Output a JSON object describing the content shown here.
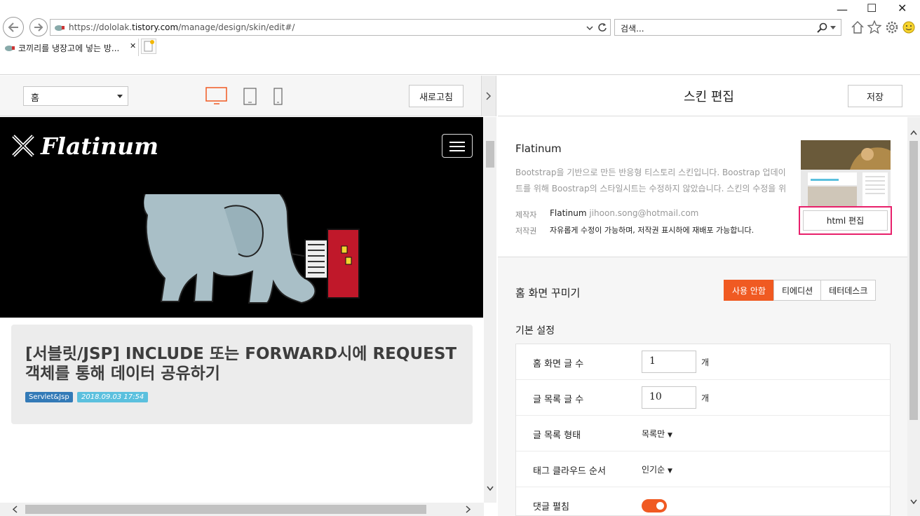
{
  "browser": {
    "url_prefix": "https://dololak.",
    "url_domain": "tistory.com",
    "url_path": "/manage/design/skin/edit#/",
    "search_placeholder": "검색...",
    "tab_title": "코끼리를 냉장고에 넣는 방..."
  },
  "preview_toolbar": {
    "page_select": "홈",
    "refresh_label": "새로고침"
  },
  "preview": {
    "logo_text": "Flatinum",
    "post_title": "[서블릿/JSP] INCLUDE 또는 FORWARD시에 REQUEST 객체를 통해 데이터 공유하기",
    "category": "Servlet&Jsp",
    "date": "2018.09.03 17:54"
  },
  "panel": {
    "title": "스킨 편집",
    "save_label": "저장",
    "skin": {
      "name": "Flatinum",
      "description": "Bootstrap을 기반으로 만든 반응형 티스토리 스킨입니다. Boostrap 업데이트를 위해 Boostrap의 스타일시트는 수정하지 않았습니다. 스킨의 수정을 위",
      "author_label": "제작자",
      "author_name": "Flatinum",
      "author_email": "jihoon.song@hotmail.com",
      "copyright_label": "저작권",
      "copyright_text": "자유롭게 수정이 가능하며, 저작권 표시하에 재배포 가능합니다.",
      "html_edit_label": "html 편집"
    },
    "home_deco": {
      "label": "홈 화면 꾸미기",
      "options": [
        "사용 안함",
        "티에디션",
        "테터데스크"
      ],
      "selected": "사용 안함"
    },
    "basic": {
      "label": "기본 설정",
      "home_posts_label": "홈 화면 글 수",
      "home_posts_value": "1",
      "list_posts_label": "글 목록 글 수",
      "list_posts_value": "10",
      "unit": "개",
      "list_type_label": "글 목록 형태",
      "list_type_value": "목록만",
      "tag_order_label": "태그 클라우드 순서",
      "tag_order_value": "인기순",
      "comments_label": "댓글 펼침",
      "comments_on": true
    }
  },
  "colors": {
    "accent": "#f05a22",
    "highlight": "#e8206b",
    "category": "#337ab7",
    "date": "#5bc0de"
  }
}
